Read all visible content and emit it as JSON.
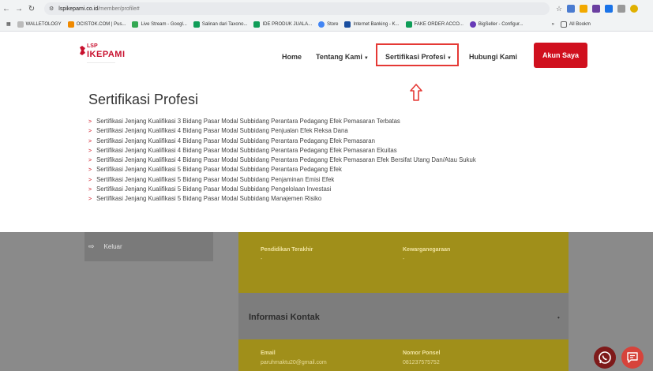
{
  "browser": {
    "url_host": "lspikepami.co.id",
    "url_path": "/member/profile#",
    "bookmarks": [
      "WALLETOLOGY",
      "OCISTOK.COM | Pus...",
      "Live Stream - Googl...",
      "Salinan dari Taxono...",
      "IDE PRODUK JUALA...",
      "Store",
      "Internet Banking - K...",
      "FAKE ORDER ACCO...",
      "BigSeller - Configur..."
    ],
    "all_bookmarks": "All Bookm"
  },
  "header": {
    "logo_top": "LSP",
    "logo_name": "IKEPAMI",
    "nav": {
      "home": "Home",
      "tentang": "Tentang Kami",
      "sertifikasi": "Sertifikasi Profesi",
      "hubungi": "Hubungi Kami"
    },
    "akun_button": "Akun Saya"
  },
  "dropdown": {
    "title": "Sertifikasi Profesi",
    "items": [
      "Sertifikasi Jenjang Kualifikasi 3 Bidang Pasar Modal Subbidang Perantara Pedagang Efek Pemasaran Terbatas",
      "Sertifikasi Jenjang Kualifikasi 4 Bidang Pasar Modal Subbidang Penjualan Efek Reksa Dana",
      "Sertifikasi Jenjang Kualifikasi 4 Bidang Pasar Modal Subbidang Perantara Pedagang Efek Pemasaran",
      "Sertifikasi Jenjang Kualifikasi 4 Bidang Pasar Modal Subbidang Perantara Pedagang Efek Pemasaran Ekuitas",
      "Sertifikasi Jenjang Kualifikasi 4 Bidang Pasar Modal Subbidang Perantara Pedagang Efek Pemasaran Efek Bersifat Utang Dan/Atau Sukuk",
      "Sertifikasi Jenjang Kualifikasi 5 Bidang Pasar Modal Subbidang Perantara Pedagang Efek",
      "Sertifikasi Jenjang Kualifikasi 5 Bidang Pasar Modal Subbidang Penjaminan Emisi Efek",
      "Sertifikasi Jenjang Kualifikasi 5 Bidang Pasar Modal Subbidang Pengelolaan Investasi",
      "Sertifikasi Jenjang Kualifikasi 5 Bidang Pasar Modal Subbidang Manajemen Risiko"
    ]
  },
  "sidebar": {
    "logout": "Keluar"
  },
  "profile": {
    "pendidikan_label": "Pendidikan Terakhir",
    "pendidikan_value": "-",
    "kewarganegaraan_label": "Kewarganegaraan",
    "kewarganegaraan_value": "-",
    "kontak_heading": "Informasi Kontak",
    "email_label": "Email",
    "email_value": "paruhmaktu20@gmail.com",
    "phone_label": "Nomor Ponsel",
    "phone_value": "081237575752"
  }
}
